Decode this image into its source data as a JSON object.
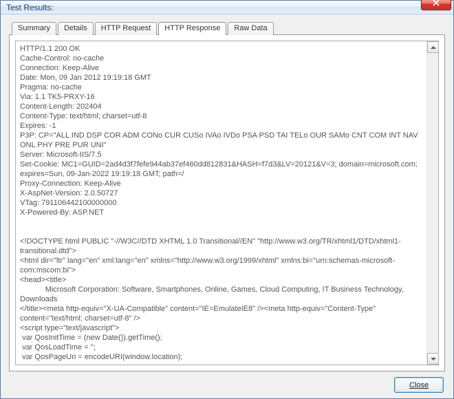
{
  "window": {
    "title": "Test Results:"
  },
  "tabs": [
    {
      "label": "Summary"
    },
    {
      "label": "Details"
    },
    {
      "label": "HTTP Request"
    },
    {
      "label": "HTTP Response"
    },
    {
      "label": "Raw Data"
    }
  ],
  "active_tab": 3,
  "response_body": "HTTP/1.1 200 OK\nCache-Control: no-cache\nConnection: Keep-Alive\nDate: Mon, 09 Jan 2012 19:19:18 GMT\nPragma: no-cache\nVia: 1.1 TK5-PRXY-16\nContent-Length: 202404\nContent-Type: text/html; charset=utf-8\nExpires: -1\nP3P: CP=\"ALL IND DSP COR ADM CONo CUR CUSo IVAo IVDo PSA PSD TAI TELo OUR SAMo CNT COM INT NAV ONL PHY PRE PUR UNI\"\nServer: Microsoft-IIS/7.5\nSet-Cookie: MC1=GUID=2ad4d3f7fefe944ab37ef460dd812831&HASH=f7d3&LV=20121&V=3; domain=microsoft.com; expires=Sun, 09-Jan-2022 19:19:18 GMT; path=/\nProxy-Connection: Keep-Alive\nX-AspNet-Version: 2.0.50727\nVTag: 791106442100000000\nX-Powered-By: ASP.NET\n\n\n<!DOCTYPE html PUBLIC \"-//W3C//DTD XHTML 1.0 Transitional//EN\" \"http://www.w3.org/TR/xhtml1/DTD/xhtml1-transitional.dtd\">\n<html dir=\"ltr\" lang=\"en\" xml:lang=\"en\" xmlns=\"http://www.w3.org/1999/xhtml\" xmlns:bi=\"urn:schemas-microsoft-com:mscom:bi\">\n<head><title>\n            Microsoft Corporation: Software, Smartphones, Online, Games, Cloud Computing, IT Business Technology, Downloads\n</title><meta http-equiv=\"X-UA-Compatible\" content=\"IE=EmulateIE8\" /><meta http-equiv=\"Content-Type\" content=\"text/html; charset=utf-8\" />\n<script type=\"text/javascript\">\n var QosInitTime = (new Date()).getTime();\n var QosLoadTime = '';\n var QosPageUri = encodeURI(window.location);",
  "buttons": {
    "close": "Close"
  }
}
